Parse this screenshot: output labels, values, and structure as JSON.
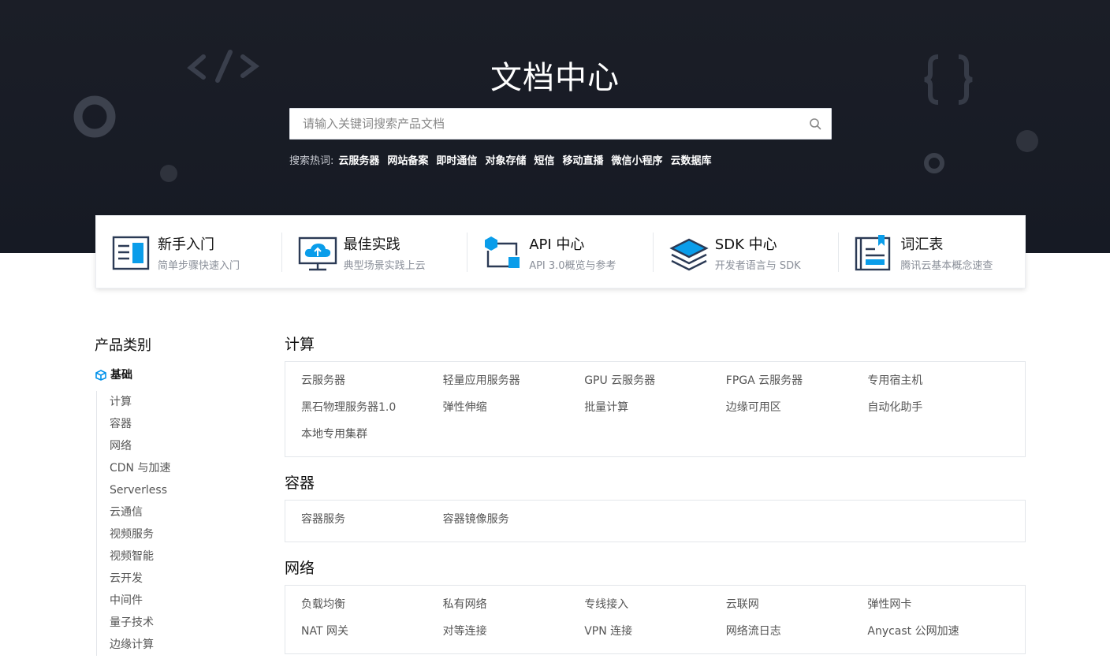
{
  "hero": {
    "title": "文档中心",
    "search_placeholder": "请输入关键词搜索产品文档",
    "hot_label": "搜索热词:",
    "hot_keywords": [
      "云服务器",
      "网站备案",
      "即时通信",
      "对象存储",
      "短信",
      "移动直播",
      "微信小程序",
      "云数据库"
    ]
  },
  "quick_links": [
    {
      "title": "新手入门",
      "desc": "简单步骤快速入门",
      "icon": "book-icon"
    },
    {
      "title": "最佳实践",
      "desc": "典型场景实践上云",
      "icon": "cloud-monitor-icon"
    },
    {
      "title": "API 中心",
      "desc": "API 3.0概览与参考",
      "icon": "api-flow-icon"
    },
    {
      "title": "SDK 中心",
      "desc": "开发者语言与 SDK",
      "icon": "layers-icon"
    },
    {
      "title": "词汇表",
      "desc": "腾讯云基本概念速查",
      "icon": "glossary-icon"
    }
  ],
  "sidebar": {
    "title": "产品类别",
    "category": "基础",
    "items": [
      "计算",
      "容器",
      "网络",
      "CDN 与加速",
      "Serverless",
      "云通信",
      "视频服务",
      "视频智能",
      "云开发",
      "中间件",
      "量子技术",
      "边缘计算"
    ]
  },
  "sections": [
    {
      "title": "计算",
      "products": [
        "云服务器",
        "轻量应用服务器",
        "GPU 云服务器",
        "FPGA 云服务器",
        "专用宿主机",
        "黑石物理服务器1.0",
        "弹性伸缩",
        "批量计算",
        "边缘可用区",
        "自动化助手",
        "本地专用集群"
      ]
    },
    {
      "title": "容器",
      "products": [
        "容器服务",
        "容器镜像服务"
      ]
    },
    {
      "title": "网络",
      "products": [
        "负载均衡",
        "私有网络",
        "专线接入",
        "云联网",
        "弹性网卡",
        "NAT 网关",
        "对等连接",
        "VPN 连接",
        "网络流日志",
        "Anycast 公网加速"
      ]
    }
  ],
  "colors": {
    "hero_bg": "#1b1e27",
    "accent": "#0091ea",
    "icon_blue": "#0a9dea",
    "icon_navy": "#2b3a55"
  }
}
